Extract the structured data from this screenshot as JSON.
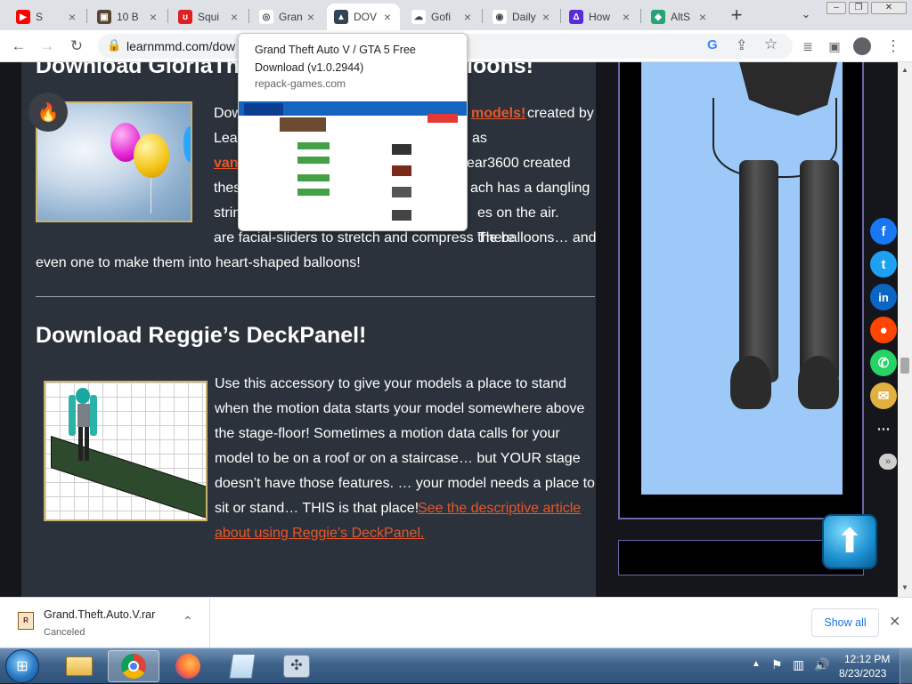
{
  "browser": {
    "tabs": [
      {
        "title": "S",
        "icon": "youtube-icon",
        "color": "#ff0000",
        "glyph": "▶"
      },
      {
        "title": "10 B",
        "icon": "site-icon",
        "color": "#5a4632",
        "glyph": "▣"
      },
      {
        "title": "Squi",
        "icon": "site-icon",
        "color": "#e02020",
        "glyph": "ʊ"
      },
      {
        "title": "Gran",
        "icon": "site-icon",
        "color": "#ffffff",
        "glyph": "◎"
      },
      {
        "title": "DOV",
        "icon": "site-icon",
        "color": "#334455",
        "glyph": "▲"
      },
      {
        "title": "Gofi",
        "icon": "site-icon",
        "color": "#ffffff",
        "glyph": "☁"
      },
      {
        "title": "Daily",
        "icon": "site-icon",
        "color": "#ffffff",
        "glyph": "◉"
      },
      {
        "title": "How",
        "icon": "site-icon",
        "color": "#5b2bd6",
        "glyph": "Δ"
      },
      {
        "title": "AltS",
        "icon": "site-icon",
        "color": "#27a376",
        "glyph": "◆"
      }
    ],
    "url": "learnmmd.com/dow",
    "hover_card": {
      "title": "Grand Theft Auto V / GTA 5 Free Download (v1.0.2944)",
      "domain": "repack-games.com"
    }
  },
  "article": {
    "section1_heading_left": "Download GloriaThe",
    "section1_heading_right": "loons!",
    "section1_p": {
      "l1a": "Dow",
      "l1_link": "models!",
      "l1b": "created by",
      "l2a": "Lea",
      "l2b": "as",
      "l3a": "van",
      "l3b": "ear3600 created",
      "l4a": "thes",
      "l4b": "ach has a dangling",
      "l5a": "strin",
      "l5b": "es on the air. There",
      "l6": "are facial-sliders to stretch and compress the balloons… and",
      "l7": "even one to make them into heart-shaped balloons!"
    },
    "section2_heading": "Download Reggie’s DeckPanel!",
    "section2_p": {
      "l1": "Use this accessory to give your models a place to stand",
      "l2": "when the motion data starts your model somewhere above",
      "l3": "the stage-floor! Sometimes a motion data calls for your",
      "l4": "model to be on a roof or on a staircase… but YOUR stage",
      "l5": "doesn’t have those features. … your model needs a place to",
      "l6a": "sit or stand… THIS is that place!",
      "l6_link": "See the descriptive article",
      "l7_link": "about using Reggie’s DeckPanel."
    }
  },
  "download_shelf": {
    "filename": "Grand.Theft.Auto.V.rar",
    "status": "Canceled",
    "show_all": "Show all"
  },
  "taskbar": {
    "time": "12:12 PM",
    "date": "8/23/2023"
  }
}
